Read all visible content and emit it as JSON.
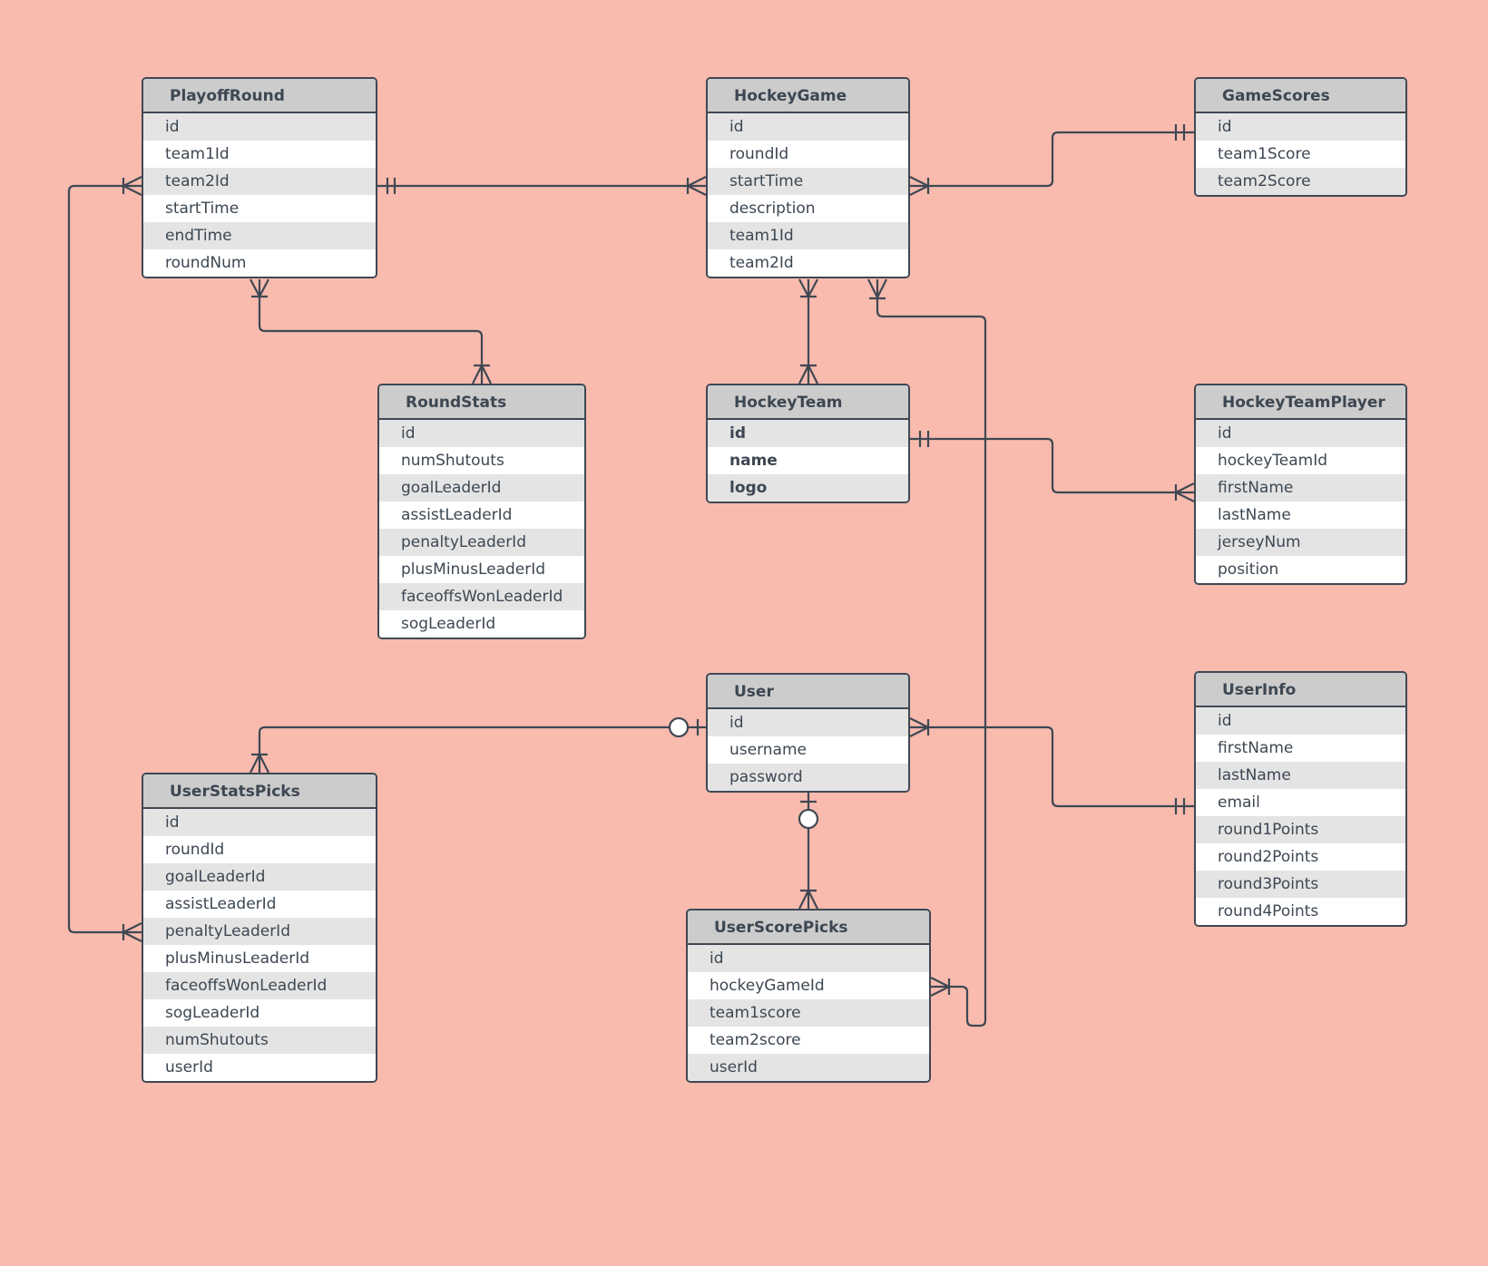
{
  "diagram": {
    "type": "entity-relationship",
    "colors": {
      "background": "#f8bbae",
      "header": "#cccccc",
      "row_alt": "#e4e4e4",
      "row": "#ffffff",
      "stroke": "#3f4853"
    },
    "entities": {
      "playoffRound": {
        "title": "PlayoffRound",
        "fields": [
          "id",
          "team1Id",
          "team2Id",
          "startTime",
          "endTime",
          "roundNum"
        ]
      },
      "hockeyGame": {
        "title": "HockeyGame",
        "fields": [
          "id",
          "roundId",
          "startTime",
          "description",
          "team1Id",
          "team2Id"
        ]
      },
      "gameScores": {
        "title": "GameScores",
        "fields": [
          "id",
          "team1Score",
          "team2Score"
        ]
      },
      "roundStats": {
        "title": "RoundStats",
        "fields": [
          "id",
          "numShutouts",
          "goalLeaderId",
          "assistLeaderId",
          "penaltyLeaderId",
          "plusMinusLeaderId",
          "faceoffsWonLeaderId",
          "sogLeaderId"
        ]
      },
      "hockeyTeam": {
        "title": "HockeyTeam",
        "fields": [
          "id",
          "name",
          "logo"
        ]
      },
      "hockeyTeamPlayer": {
        "title": "HockeyTeamPlayer",
        "fields": [
          "id",
          "hockeyTeamId",
          "firstName",
          "lastName",
          "jerseyNum",
          "position"
        ]
      },
      "user": {
        "title": "User",
        "fields": [
          "id",
          "username",
          "password"
        ]
      },
      "userInfo": {
        "title": "UserInfo",
        "fields": [
          "id",
          "firstName",
          "lastName",
          "email",
          "round1Points",
          "round2Points",
          "round3Points",
          "round4Points"
        ]
      },
      "userStatsPicks": {
        "title": "UserStatsPicks",
        "fields": [
          "id",
          "roundId",
          "goalLeaderId",
          "assistLeaderId",
          "penaltyLeaderId",
          "plusMinusLeaderId",
          "faceoffsWonLeaderId",
          "sogLeaderId",
          "numShutouts",
          "userId"
        ]
      },
      "userScorePicks": {
        "title": "UserScorePicks",
        "fields": [
          "id",
          "hockeyGameId",
          "team1score",
          "team2score",
          "userId"
        ]
      }
    },
    "relationships": [
      {
        "from": "PlayoffRound",
        "from_card": "one-and-only-one",
        "to": "HockeyGame",
        "to_card": "one-or-many"
      },
      {
        "from": "HockeyGame",
        "from_card": "one-or-many",
        "to": "GameScores",
        "to_card": "one-and-only-one"
      },
      {
        "from": "PlayoffRound",
        "from_card": "one-or-many",
        "to": "RoundStats",
        "to_card": "one-or-many"
      },
      {
        "from": "HockeyGame",
        "from_card": "one-or-many",
        "to": "HockeyTeam",
        "to_card": "one-or-many"
      },
      {
        "from": "HockeyTeam",
        "from_card": "one-and-only-one",
        "to": "HockeyTeamPlayer",
        "to_card": "one-or-many"
      },
      {
        "from": "HockeyGame",
        "from_card": "one-or-many",
        "to": "UserScorePicks",
        "to_card": "one-or-many"
      },
      {
        "from": "PlayoffRound",
        "from_card": "one-or-many",
        "to": "UserStatsPicks",
        "to_card": "one-or-many"
      },
      {
        "from": "User",
        "from_card": "zero-or-one",
        "to": "UserStatsPicks",
        "to_card": "one-or-many"
      },
      {
        "from": "User",
        "from_card": "one-or-many",
        "to": "UserInfo",
        "to_card": "one-and-only-one"
      },
      {
        "from": "User",
        "from_card": "zero-or-one",
        "to": "UserScorePicks",
        "to_card": "one-or-many"
      }
    ]
  }
}
